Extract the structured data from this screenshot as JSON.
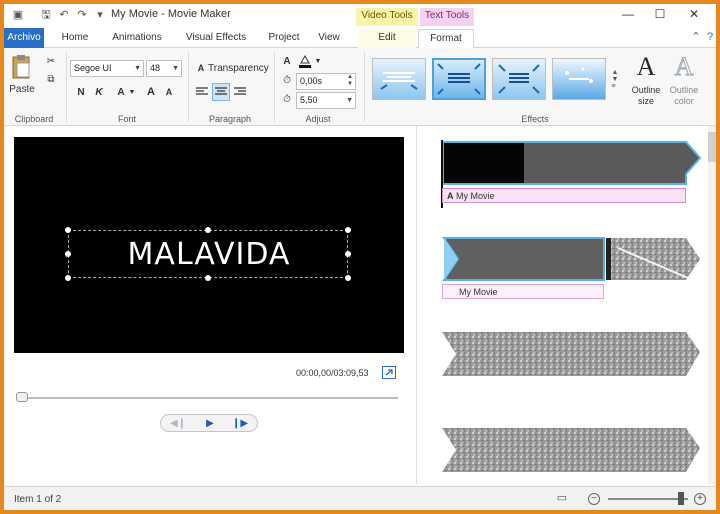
{
  "app": {
    "title": "My Movie - Movie Maker"
  },
  "context_tabs": {
    "video_tools": "Video Tools",
    "text_tools": "Text Tools"
  },
  "tabs": {
    "archivo": "Archivo",
    "home": "Home",
    "animations": "Animations",
    "visual_effects": "Visual Effects",
    "project": "Project",
    "view": "View",
    "edit": "Edit",
    "format": "Format"
  },
  "ribbon": {
    "clipboard": {
      "label": "Clipboard",
      "paste": "Paste"
    },
    "font": {
      "label": "Font",
      "family": "Segoe UI",
      "size": "48",
      "bold": "N",
      "italic": "K",
      "color": "A",
      "grow": "A",
      "shrink": "A"
    },
    "paragraph": {
      "label": "Paragraph",
      "transparency": "Transparency"
    },
    "adjust": {
      "label": "Adjust",
      "start_time": "0,00s",
      "duration": "5,50"
    },
    "effects": {
      "label": "Effects",
      "outline_size": "Outline size",
      "outline_color": "Outline color"
    }
  },
  "preview": {
    "caption": "MALAVIDA",
    "timecode": "00:00,00/03:09,53"
  },
  "storyboard": {
    "clip1_title": "My Movie",
    "clip2_title": "My Movie"
  },
  "status": {
    "item": "Item 1 of 2"
  },
  "colors": {
    "frame": "#e8881c",
    "accent": "#2a6fc7",
    "video_tools_bg": "#fbf4a8",
    "text_tools_bg": "#f6d2f0",
    "selection": "#4aa3df"
  }
}
